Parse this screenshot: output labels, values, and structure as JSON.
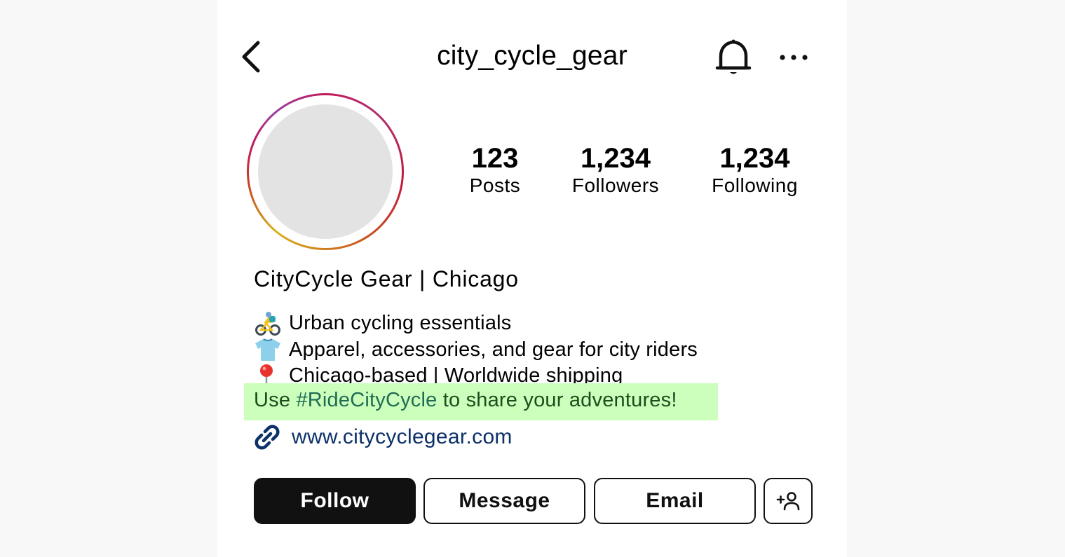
{
  "header": {
    "username": "city_cycle_gear",
    "back_icon": "chevron-left-icon",
    "notifications_icon": "bell-icon",
    "more_icon": "more-horizontal-icon"
  },
  "profile": {
    "avatar_icon": "avatar-placeholder",
    "stats": [
      {
        "value": "123",
        "label": "Posts"
      },
      {
        "value": "1,234",
        "label": "Followers"
      },
      {
        "value": "1,234",
        "label": "Following"
      }
    ],
    "display_name": "CityCycle Gear | Chicago",
    "bio_lines": [
      {
        "emoji": "person-biking-icon",
        "text": "Urban cycling essentials"
      },
      {
        "emoji": "t-shirt-icon",
        "text": "Apparel, accessories, and gear for city riders"
      },
      {
        "emoji": "round-pushpin-icon",
        "text": "Chicago-based | Worldwide shipping"
      }
    ],
    "highlight": {
      "prefix": "Use ",
      "hashtag": "#RideCityCycle",
      "suffix": " to share your adventures!",
      "background": "#ccffbb"
    },
    "website": {
      "icon": "link-icon",
      "text": "www.citycyclegear.com",
      "color": "#0c3169"
    }
  },
  "actions": {
    "follow_label": "Follow",
    "message_label": "Message",
    "email_label": "Email",
    "add_user_icon": "add-user-icon"
  }
}
